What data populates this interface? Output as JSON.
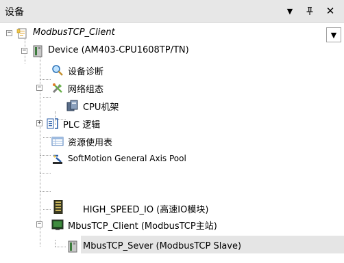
{
  "panel": {
    "title": "设备",
    "menu_glyph": "▼",
    "pin_glyph": "ᵖ",
    "close_glyph": "✕"
  },
  "tree": {
    "dropdown_glyph": "▼",
    "nodes": [
      {
        "label": "ModbusTCP_Client",
        "icon": "project-icon",
        "expander": "−"
      },
      {
        "label": "Device (AM403-CPU1608TP/TN)",
        "icon": "device-icon",
        "expander": "−"
      },
      {
        "label": "设备诊断",
        "icon": "diagnostics-icon"
      },
      {
        "label": "网络组态",
        "icon": "network-config-icon",
        "expander": "−"
      },
      {
        "label": "CPU机架",
        "icon": "cpu-rack-icon"
      },
      {
        "label": "PLC 逻辑",
        "icon": "plc-logic-icon",
        "expander": "+"
      },
      {
        "label": "资源使用表",
        "icon": "resource-table-icon"
      },
      {
        "label": "SoftMotion General Axis Pool",
        "icon": "axis-pool-icon"
      },
      {
        "label": "HIGH_SPEED_IO (高速IO模块)",
        "icon": "io-module-icon"
      },
      {
        "label": "MbusTCP_Client (ModbusTCP主站)",
        "icon": "modbus-master-icon",
        "expander": "−"
      },
      {
        "label": "MbusTCP_Sever (ModbusTCP Slave)",
        "icon": "modbus-slave-icon"
      }
    ]
  },
  "colors": {
    "titlebar_bg": "#e7e7e7",
    "selected_bg": "#e5e5e5"
  }
}
